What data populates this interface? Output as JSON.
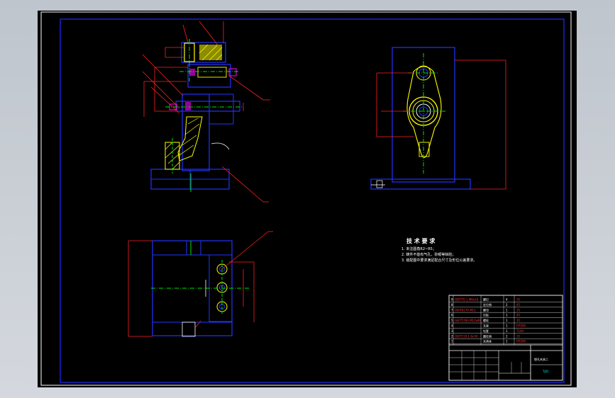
{
  "colors": {
    "sheet": "#000000",
    "frame": "#ffffff",
    "border": "#1e2cff",
    "part": "#2233ff",
    "dimension": "#ff2020",
    "centerline": "#00e000",
    "hatch": "#ffff00",
    "section": "#ff00ff",
    "text": "#ffffff"
  },
  "tech_requirements": {
    "title": "技 术 要 求",
    "items": [
      "1. 未注圆角R2~R5；",
      "2. 铸件不能有气孔、砂眼等缺陷；",
      "3. 装配图中要求满足配合尺寸及形位公差要求。"
    ]
  },
  "title_block": {
    "drawing_name": "镗孔夹具二",
    "drawing_code": "TJ01",
    "parts": [
      {
        "code": "GB/T70.1 M6x16",
        "name": "螺钉",
        "qty": "4",
        "material": "35"
      },
      {
        "code": "",
        "name": "定位销",
        "qty": "2",
        "material": "45"
      },
      {
        "code": "GB/T6170 M12",
        "name": "螺母",
        "qty": "1",
        "material": "35"
      },
      {
        "code": "",
        "name": "压板",
        "qty": "1",
        "material": "45"
      },
      {
        "code": "GB/T5783 M12x80",
        "name": "螺栓",
        "qty": "1",
        "material": "35"
      },
      {
        "code": "",
        "name": "支座",
        "qty": "1",
        "material": "HT200"
      },
      {
        "code": "",
        "name": "钻套",
        "qty": "1",
        "material": "T10A"
      },
      {
        "code": "GB/T119.1 6x30",
        "name": "圆柱销",
        "qty": "2",
        "material": "35"
      },
      {
        "code": "",
        "name": "夹具体",
        "qty": "1",
        "material": "HT200"
      }
    ]
  }
}
